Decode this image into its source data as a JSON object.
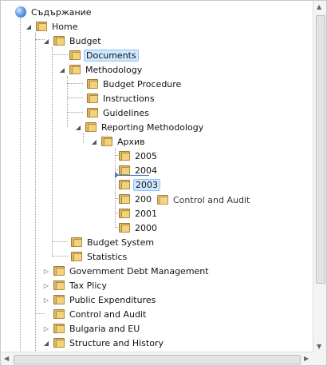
{
  "tree": {
    "root_label": "Съдържание",
    "home": "Home",
    "budget": "Budget",
    "documents": "Documents",
    "methodology": "Methodology",
    "budget_procedure": "Budget Procedure",
    "instructions": "Instructions",
    "guidelines": "Guidelines",
    "reporting_methodology": "Reporting Methodology",
    "archive": "Архив",
    "y2005": "2005",
    "y2004": "2004",
    "y2003": "2003",
    "y2002_partial": "200",
    "y2001": "2001",
    "y2000": "2000",
    "budget_system": "Budget System",
    "statistics": "Statistics",
    "government_debt_management": "Government Debt Management",
    "tax_plicy": "Tax Plicy",
    "public_expenditures": "Public Expenditures",
    "control_and_audit": "Control and Audit",
    "bulgaria_and_eu": "Bulgaria and EU",
    "structure_and_history": "Structure and History"
  },
  "drag": {
    "label": "Control and Audit"
  },
  "icons": {
    "expanded": "triangle-down-filled",
    "collapsed": "triangle-right-outline",
    "folder": "folder-icon",
    "root": "globe-icon"
  }
}
